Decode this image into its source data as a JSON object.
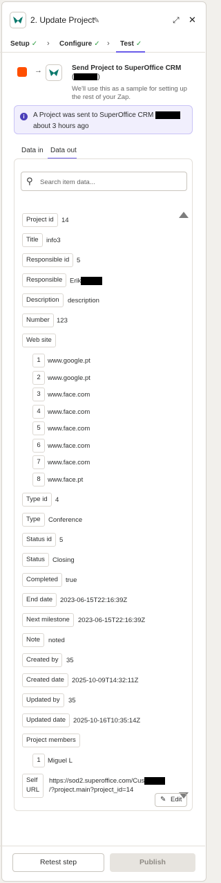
{
  "header": {
    "title": "2. Update Project"
  },
  "steps": [
    {
      "label": "Setup"
    },
    {
      "label": "Configure"
    },
    {
      "label": "Test"
    }
  ],
  "send": {
    "title": "Send Project to SuperOffice CRM",
    "subtitle": "We'll use this as a sample for setting up the rest of your Zap."
  },
  "info": {
    "line1": "A Project was sent to SuperOffice CRM",
    "line2": "about 3 hours ago"
  },
  "tabs": [
    {
      "label": "Data in"
    },
    {
      "label": "Data out"
    }
  ],
  "search": {
    "placeholder": "Search item data..."
  },
  "fields": {
    "project_id": {
      "label": "Project id",
      "value": "14"
    },
    "title": {
      "label": "Title",
      "value": "info3"
    },
    "responsible_id": {
      "label": "Responsible id",
      "value": "5"
    },
    "responsible": {
      "label": "Responsible",
      "value": "Erik"
    },
    "description": {
      "label": "Description",
      "value": "description"
    },
    "number": {
      "label": "Number",
      "value": "123"
    },
    "web_site": {
      "label": "Web site",
      "items": [
        {
          "index": "1",
          "value": "www.google.pt"
        },
        {
          "index": "2",
          "value": "www.google.pt"
        },
        {
          "index": "3",
          "value": "www.face.com"
        },
        {
          "index": "4",
          "value": "www.face.com"
        },
        {
          "index": "5",
          "value": "www.face.com"
        },
        {
          "index": "6",
          "value": "www.face.com"
        },
        {
          "index": "7",
          "value": "www.face.com"
        },
        {
          "index": "8",
          "value": "www.face.pt"
        }
      ]
    },
    "type_id": {
      "label": "Type id",
      "value": "4"
    },
    "type": {
      "label": "Type",
      "value": "Conference"
    },
    "status_id": {
      "label": "Status id",
      "value": "5"
    },
    "status": {
      "label": "Status",
      "value": "Closing"
    },
    "completed": {
      "label": "Completed",
      "value": "true"
    },
    "end_date": {
      "label": "End date",
      "value": "2023-06-15T22:16:39Z"
    },
    "next_milestone": {
      "label": "Next milestone",
      "value": "2023-06-15T22:16:39Z"
    },
    "note": {
      "label": "Note",
      "value": "noted"
    },
    "created_by": {
      "label": "Created by",
      "value": "35"
    },
    "created_date": {
      "label": "Created date",
      "value": "2025-10-09T14:32:11Z"
    },
    "updated_by": {
      "label": "Updated by",
      "value": "35"
    },
    "updated_date": {
      "label": "Updated date",
      "value": "2025-10-16T10:35:14Z"
    },
    "project_members": {
      "label": "Project members",
      "items": [
        {
          "index": "1",
          "value": "Miguel L"
        }
      ]
    },
    "self_url": {
      "label_line1": "Self",
      "label_line2": "URL",
      "value_line1": "https://sod2.superoffice.com/Cus",
      "value_line2": "/?project.main?project_id=14"
    }
  },
  "actions": {
    "edit": "Edit",
    "retest": "Retest step",
    "publish": "Publish"
  },
  "colors": {
    "accent": "#695be8",
    "brand_orange": "#ff4f00",
    "check_green": "#2f9e44",
    "info_bg": "#f1effd"
  }
}
